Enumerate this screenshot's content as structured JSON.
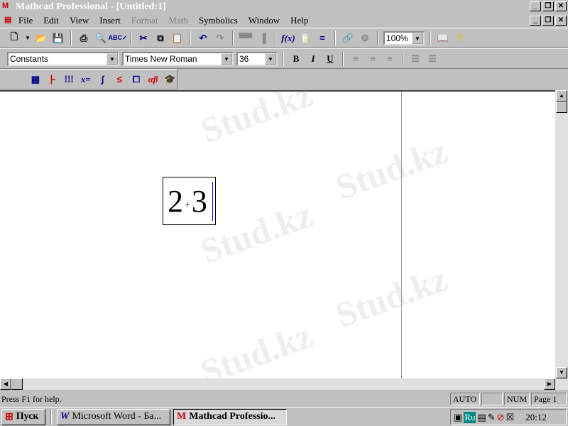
{
  "window": {
    "title": "Mathcad Professional - [Untitled:1]",
    "min": "_",
    "restore": "❐",
    "close": "✕"
  },
  "menu": [
    {
      "label": "File",
      "enabled": true
    },
    {
      "label": "Edit",
      "enabled": true
    },
    {
      "label": "View",
      "enabled": true
    },
    {
      "label": "Insert",
      "enabled": true
    },
    {
      "label": "Format",
      "enabled": false
    },
    {
      "label": "Math",
      "enabled": false
    },
    {
      "label": "Symbolics",
      "enabled": true
    },
    {
      "label": "Window",
      "enabled": true
    },
    {
      "label": "Help",
      "enabled": true
    }
  ],
  "toolbar": {
    "zoom": "100%",
    "fx": "f(x)",
    "help": "?"
  },
  "format_bar": {
    "style": "Constants",
    "font": "Times New Roman",
    "size": "36",
    "bold": "B",
    "italic": "I",
    "underline": "U"
  },
  "math_bar": {
    "eval": "x=",
    "greek": "αβ"
  },
  "document": {
    "expr_left": "2",
    "expr_op": "+",
    "expr_right": "3"
  },
  "status": {
    "help": "Press F1 for help.",
    "mode": "AUTO",
    "blank": "",
    "num": "NUM",
    "page": "Page 1"
  },
  "taskbar": {
    "start": "Пуск",
    "tasks": [
      "Microsoft Word - Ба...",
      "Mathcad Professio..."
    ],
    "lang": "Ru",
    "clock": "20:12"
  },
  "watermark": "Stud.kz"
}
